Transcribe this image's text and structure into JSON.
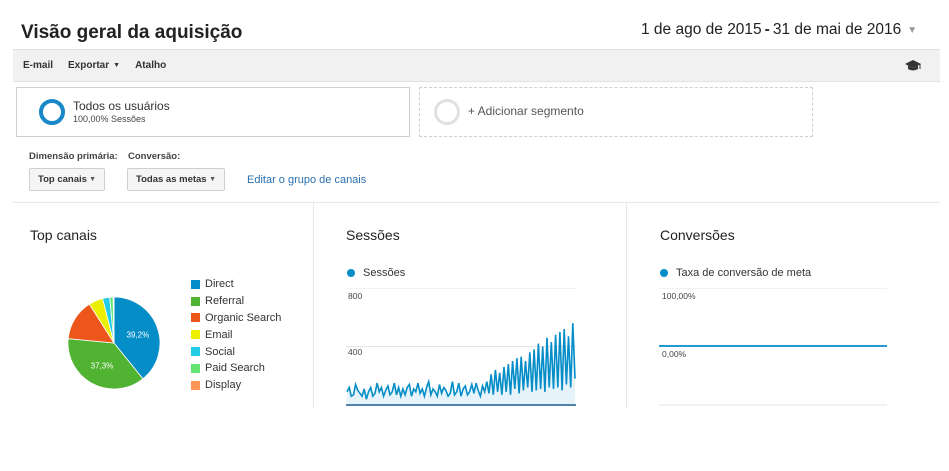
{
  "header": {
    "title": "Visão geral da aquisição",
    "date_start": "1 de ago de 2015",
    "date_sep": "-",
    "date_end": "31 de mai de 2016"
  },
  "toolbar": {
    "email_label": "E-mail",
    "export_label": "Exportar",
    "shortcut_label": "Atalho",
    "academy_icon": "graduation-cap-icon"
  },
  "segments": {
    "active": {
      "name": "Todos os usuários",
      "detail": "100,00% Sessões"
    },
    "add_label": "+ Adicionar segmento"
  },
  "controls": {
    "primary_dimension_label": "Dimensão primária:",
    "primary_dimension_value": "Top canais",
    "conversion_label": "Conversão:",
    "conversion_value": "Todas as metas",
    "edit_link": "Editar o grupo de canais"
  },
  "panels": {
    "top_channels_title": "Top canais",
    "sessions_title": "Sessões",
    "conversions_title": "Conversões",
    "sessions_series": "Sessões",
    "conversions_series": "Taxa de conversão de meta",
    "sessions_tick_high": "800",
    "sessions_tick_mid": "400",
    "conversions_tick_high": "100,00%",
    "conversions_tick_low": "0,00%"
  },
  "colors": {
    "accent": "#058dc7",
    "link": "#2a6fae"
  },
  "chart_data": [
    {
      "type": "pie",
      "title": "Top canais",
      "slices": [
        {
          "label": "Direct",
          "value": 39.2,
          "display": "39,2%",
          "color": "#058dc7"
        },
        {
          "label": "Referral",
          "value": 37.3,
          "display": "37,3%",
          "color": "#50b432"
        },
        {
          "label": "Organic Search",
          "value": 14.5,
          "color": "#ed561b"
        },
        {
          "label": "Email",
          "value": 5.0,
          "color": "#edef00"
        },
        {
          "label": "Social",
          "value": 2.5,
          "color": "#24cbe5"
        },
        {
          "label": "Paid Search",
          "value": 1.2,
          "color": "#64e572"
        },
        {
          "label": "Display",
          "value": 0.3,
          "color": "#ff9655"
        }
      ]
    },
    {
      "type": "area",
      "title": "Sessões",
      "series": [
        {
          "name": "Sessões",
          "values": [
            90,
            120,
            60,
            70,
            140,
            100,
            80,
            60,
            110,
            40,
            90,
            120,
            60,
            80,
            150,
            90,
            120,
            60,
            100,
            130,
            70,
            90,
            150,
            70,
            120,
            60,
            110,
            70,
            120,
            140,
            60,
            110,
            90,
            150,
            80,
            110,
            60,
            120,
            160,
            70,
            110,
            90,
            60,
            140,
            80,
            120,
            100,
            60,
            80,
            160,
            70,
            90,
            150,
            60,
            110,
            130,
            70,
            90,
            140,
            80,
            150,
            100,
            60,
            130,
            90,
            160,
            80,
            210,
            70,
            240,
            90,
            220,
            70,
            260,
            90,
            280,
            70,
            300,
            110,
            320,
            80,
            330,
            100,
            300,
            120,
            360,
            90,
            380,
            100,
            420,
            110,
            400,
            90,
            460,
            120,
            430,
            110,
            480,
            120,
            500,
            100,
            520,
            140,
            470,
            120,
            560,
            180
          ]
        }
      ],
      "ylim": [
        0,
        800
      ],
      "yticks": [
        400,
        800
      ]
    },
    {
      "type": "line",
      "title": "Conversões",
      "series": [
        {
          "name": "Taxa de conversão de meta",
          "values": [
            0,
            0,
            0,
            0,
            0,
            0,
            0,
            0,
            0,
            0
          ]
        }
      ],
      "ylim": [
        0,
        100
      ],
      "yticks": [
        0,
        100
      ]
    }
  ]
}
